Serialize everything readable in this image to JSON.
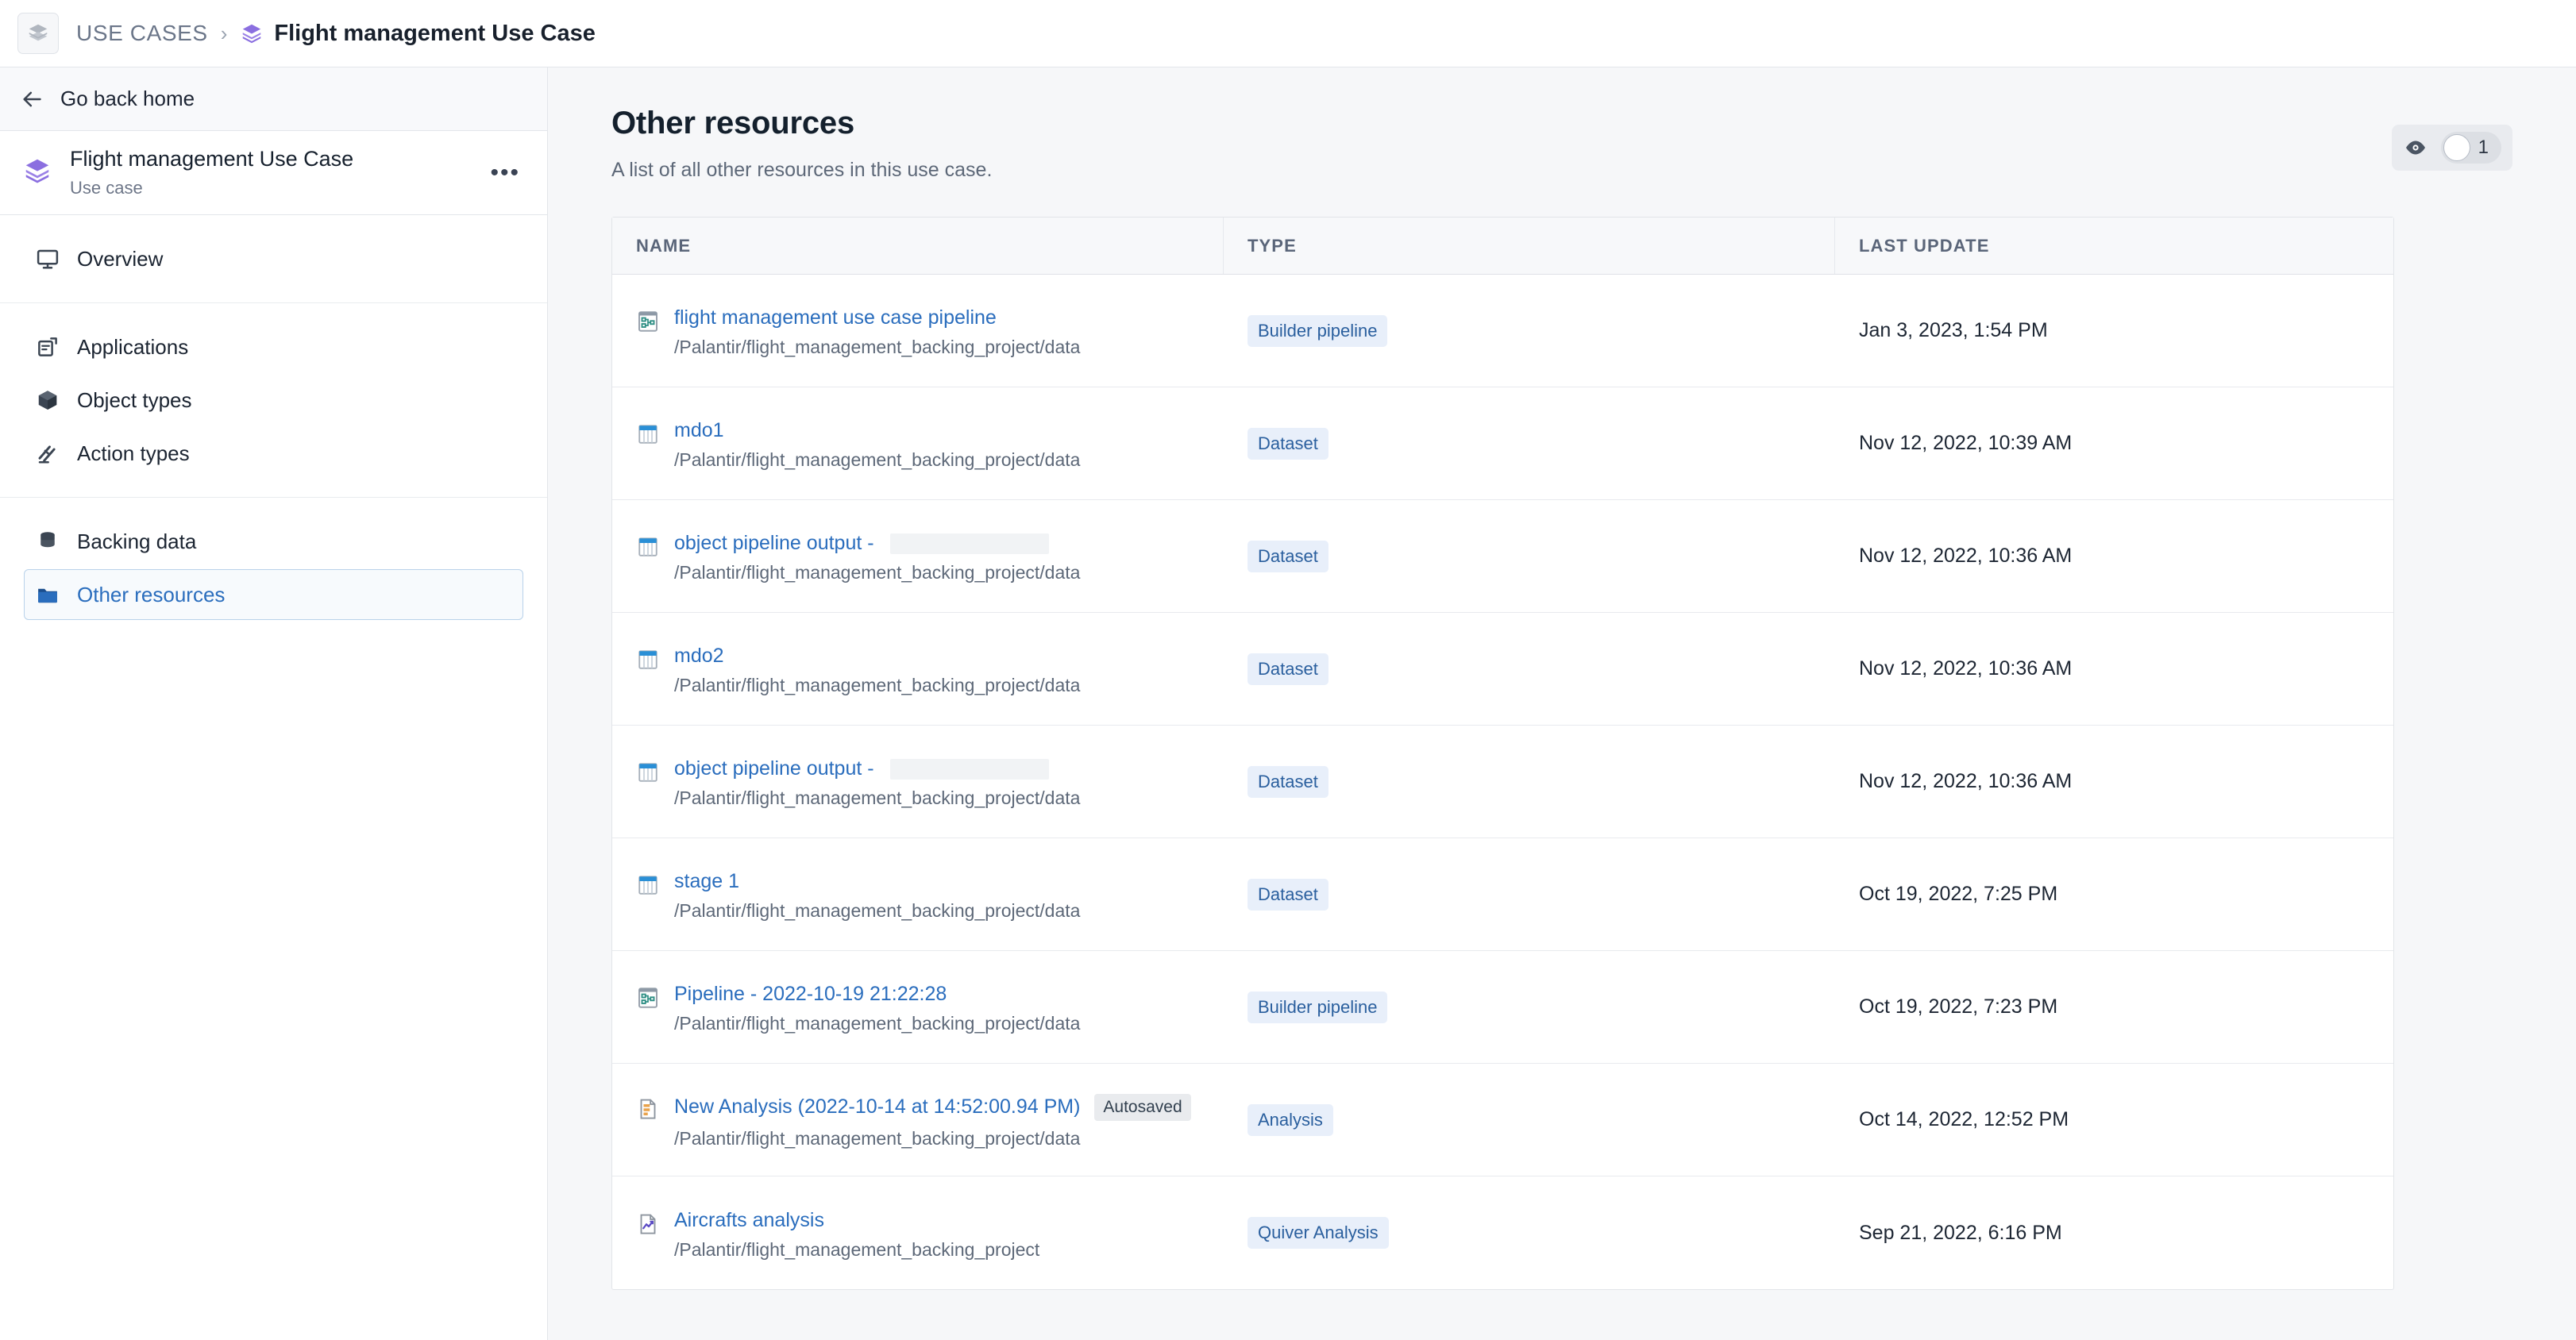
{
  "topbar": {
    "app_icon": "layers-icon",
    "breadcrumb_root": "USE CASES",
    "breadcrumb_separator": "›",
    "breadcrumb_leaf": "Flight management Use Case",
    "breadcrumb_leaf_icon": "layers-purple-icon"
  },
  "sidebar": {
    "go_back_label": "Go back home",
    "go_back_icon": "arrow-left-icon",
    "use_case": {
      "icon": "layers-purple-icon",
      "title": "Flight management Use Case",
      "subtitle": "Use case",
      "more_label": "•••"
    },
    "groups": [
      {
        "items": [
          {
            "label": "Overview",
            "icon": "desktop-icon",
            "active": false
          }
        ]
      },
      {
        "items": [
          {
            "label": "Applications",
            "icon": "applications-icon",
            "active": false
          },
          {
            "label": "Object types",
            "icon": "cube-icon",
            "active": false
          },
          {
            "label": "Action types",
            "icon": "action-icon",
            "active": false
          }
        ]
      },
      {
        "items": [
          {
            "label": "Backing data",
            "icon": "database-icon",
            "active": false
          },
          {
            "label": "Other resources",
            "icon": "folder-icon",
            "active": true
          }
        ]
      }
    ]
  },
  "main": {
    "title": "Other resources",
    "subtitle": "A list of all other resources in this use case.",
    "viewers": {
      "eye_icon": "eye-icon",
      "count": "1"
    },
    "table": {
      "columns": [
        "NAME",
        "TYPE",
        "LAST UPDATE"
      ],
      "rows": [
        {
          "icon": "pipeline-icon",
          "name": "flight management use case pipeline",
          "redacted_width": 0,
          "badge_label": null,
          "path": "/Palantir/flight_management_backing_project/data",
          "type": "Builder pipeline",
          "last_update": "Jan 3, 2023, 1:54 PM"
        },
        {
          "icon": "dataset-icon",
          "name": "mdo1",
          "redacted_width": 0,
          "badge_label": null,
          "path": "/Palantir/flight_management_backing_project/data",
          "type": "Dataset",
          "last_update": "Nov 12, 2022, 10:39 AM"
        },
        {
          "icon": "dataset-icon",
          "name": "object pipeline output -",
          "redacted_width": 200,
          "badge_label": null,
          "path": "/Palantir/flight_management_backing_project/data",
          "type": "Dataset",
          "last_update": "Nov 12, 2022, 10:36 AM"
        },
        {
          "icon": "dataset-icon",
          "name": "mdo2",
          "redacted_width": 0,
          "badge_label": null,
          "path": "/Palantir/flight_management_backing_project/data",
          "type": "Dataset",
          "last_update": "Nov 12, 2022, 10:36 AM"
        },
        {
          "icon": "dataset-icon",
          "name": "object pipeline output -",
          "redacted_width": 200,
          "badge_label": null,
          "path": "/Palantir/flight_management_backing_project/data",
          "type": "Dataset",
          "last_update": "Nov 12, 2022, 10:36 AM"
        },
        {
          "icon": "dataset-icon",
          "name": "stage 1",
          "redacted_width": 0,
          "badge_label": null,
          "path": "/Palantir/flight_management_backing_project/data",
          "type": "Dataset",
          "last_update": "Oct 19, 2022, 7:25 PM"
        },
        {
          "icon": "pipeline-icon",
          "name": "Pipeline - 2022-10-19 21:22:28",
          "redacted_width": 0,
          "badge_label": null,
          "path": "/Palantir/flight_management_backing_project/data",
          "type": "Builder pipeline",
          "last_update": "Oct 19, 2022, 7:23 PM"
        },
        {
          "icon": "analysis-icon",
          "name": "New Analysis (2022-10-14 at 14:52:00.94 PM)",
          "redacted_width": 0,
          "badge_label": "Autosaved",
          "path": "/Palantir/flight_management_backing_project/data",
          "type": "Analysis",
          "last_update": "Oct 14, 2022, 12:52 PM"
        },
        {
          "icon": "quiver-icon",
          "name": "Aircrafts analysis",
          "redacted_width": 0,
          "badge_label": null,
          "path": "/Palantir/flight_management_backing_project",
          "type": "Quiver Analysis",
          "last_update": "Sep 21, 2022, 6:16 PM"
        }
      ]
    }
  },
  "colors": {
    "link": "#2a6dbd",
    "badge_bg": "#e8effa",
    "badge_fg": "#2a5f9e",
    "accent_purple": "#8b6fe0",
    "page_bg": "#f6f7f9",
    "active_nav_border": "#b9d2ea"
  }
}
